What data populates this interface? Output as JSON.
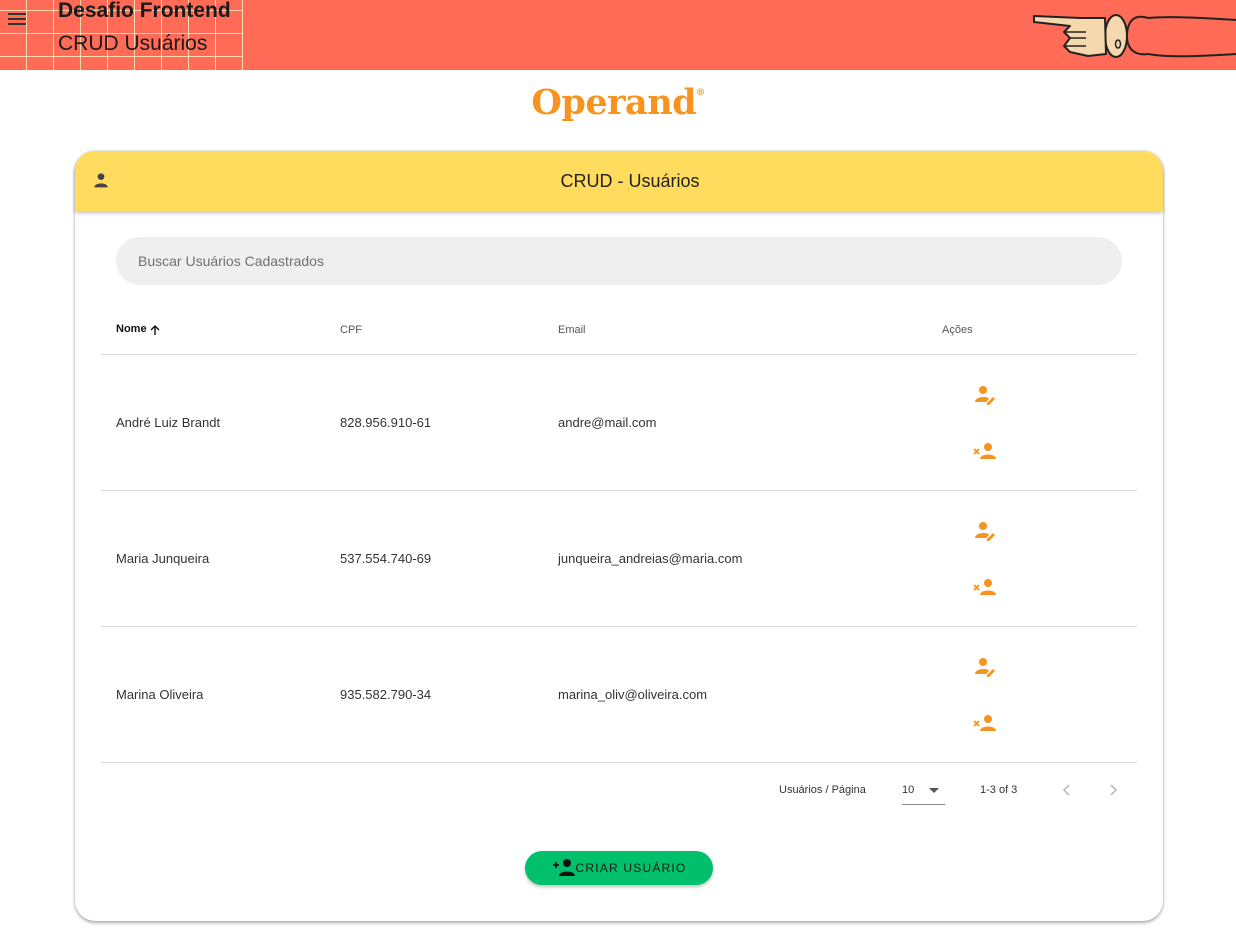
{
  "header": {
    "title": "Desafio Frontend",
    "subtitle": "CRUD Usuários",
    "menu_icon": "menu-icon",
    "illustration": "pointing-hand-illustration",
    "color": "#ff6b57"
  },
  "logo": {
    "text": "Operand",
    "mark": "®",
    "color": "#f7931e"
  },
  "card": {
    "title": "CRUD - Usuários",
    "icon": "person-icon",
    "header_color": "#ffdb5e"
  },
  "search": {
    "placeholder": "Buscar Usuários Cadastrados",
    "value": ""
  },
  "table": {
    "columns": [
      "Nome",
      "CPF",
      "Email",
      "Ações"
    ],
    "sorted_column": "Nome",
    "sort_direction": "ascending",
    "rows": [
      {
        "name": "André Luiz Brandt",
        "cpf": "828.956.910-61",
        "email": "andre@mail.com"
      },
      {
        "name": "Maria Junqueira",
        "cpf": "537.554.740-69",
        "email": "junqueira_andreias@maria.com"
      },
      {
        "name": "Marina Oliveira",
        "cpf": "935.582.790-34",
        "email": "marina_oliv@oliveira.com"
      }
    ],
    "action_icons": [
      "edit-user-icon",
      "remove-user-icon"
    ],
    "action_color": "#f7931e"
  },
  "pagination": {
    "label": "Usuários / Página",
    "page_size": "10",
    "range": "1-3 of 3"
  },
  "create_button": {
    "label": "CRIAR USUÁRIO",
    "icon": "add-user-icon",
    "color": "#00c06b"
  }
}
